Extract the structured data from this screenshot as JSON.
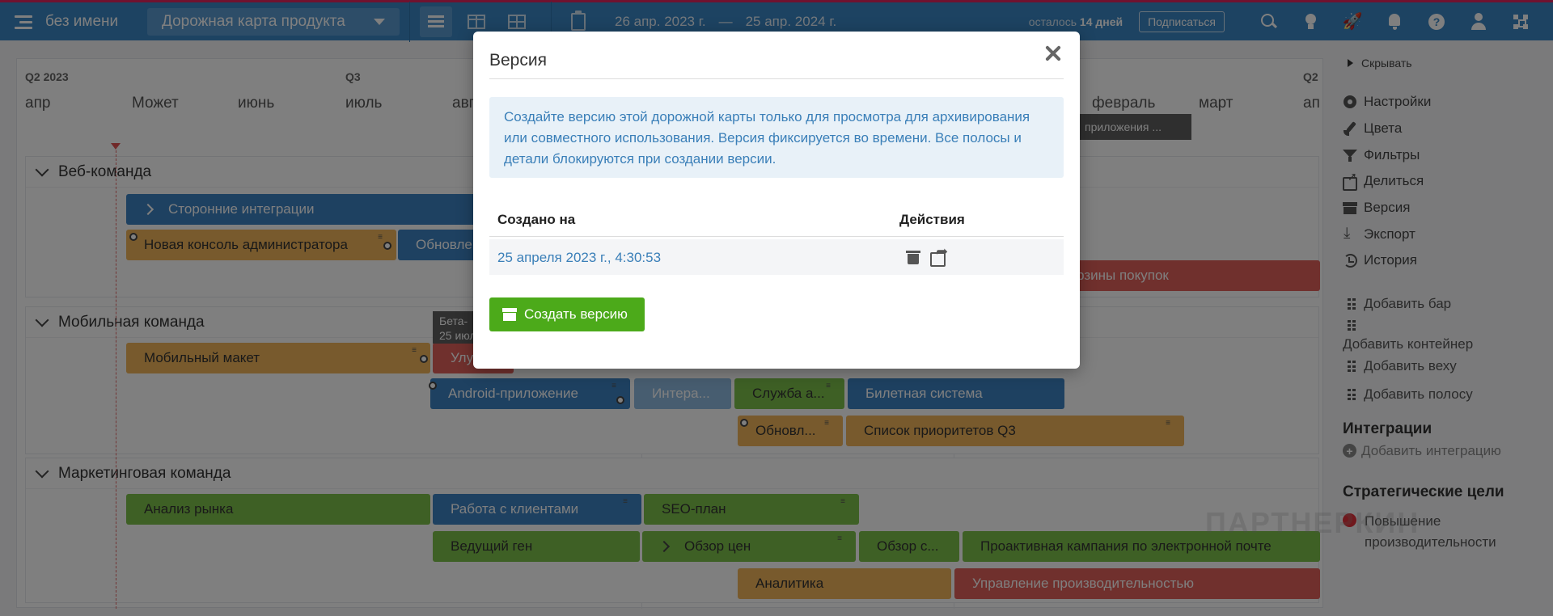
{
  "app": {
    "name": "без имени",
    "roadmap": "Дорожная карта продукта",
    "date_start": "26 апр. 2023 г.",
    "date_sep": "—",
    "date_end": "25 апр. 2024 г.",
    "trial_prefix": "осталось",
    "trial_days": "14 дней",
    "subscribe": "Подписаться"
  },
  "timeline": {
    "quarters": [
      "Q2 2023",
      "Q3",
      "Q2"
    ],
    "months": [
      "апр",
      "Может",
      "июнь",
      "июль",
      "авг",
      "февраль",
      "март",
      "ап"
    ]
  },
  "teams": [
    {
      "name": "Веб-команда",
      "bars": [
        "Сторонние интеграции",
        "Новая консоль администратора",
        "Обновле",
        "корзины покупок"
      ]
    },
    {
      "name": "Мобильная команда",
      "bars": [
        "Мобильный макет",
        "Улу",
        "Android-приложение",
        "Интера...",
        "Служба а...",
        "Билетная система",
        "Обновл...",
        "Список приоритетов Q3"
      ]
    },
    {
      "name": "Маркетинговая команда",
      "bars": [
        "Анализ рынка",
        "Работа с клиентами",
        "SEO-план",
        "Ведущий ген",
        "Обзор цен",
        "Обзор с...",
        "Проактивная кампания по электронной почте",
        "Аналитика",
        "Управление производительностью"
      ]
    }
  ],
  "milestones": [
    {
      "line1": "Бета-",
      "line2": "25 июл"
    },
    {
      "line1": "приложения ...",
      "line2": ""
    }
  ],
  "sidebar": {
    "hide": "Скрывать",
    "items": [
      "Настройки",
      "Цвета",
      "Фильтры",
      "Делиться",
      "Версия",
      "Экспорт",
      "История"
    ],
    "add_bar": "Добавить бар",
    "add_container": "Добавить контейнер",
    "add_milestone": "Добавить веху",
    "add_lane": "Добавить полосу",
    "integrations_title": "Интеграции",
    "add_integration": "Добавить интеграцию",
    "goals_title": "Стратегические цели",
    "goal1": "Повышение производительности"
  },
  "watermark": "ПАРТНЕРКИН",
  "modal": {
    "title": "Версия",
    "info": "Создайте версию этой дорожной карты только для просмотра для архивирования или совместного использования. Версия фиксируется во времени. Все полосы и детали блокируются при создании версии.",
    "col_created": "Создано на",
    "col_actions": "Действия",
    "rows": [
      {
        "created": "25 апреля 2023 г., 4:30:53"
      }
    ],
    "create_button": "Создать версию"
  }
}
